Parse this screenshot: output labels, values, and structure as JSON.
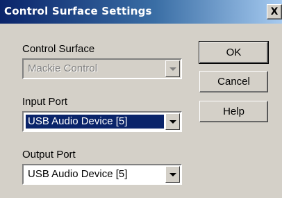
{
  "window": {
    "title": "Control Surface Settings",
    "close_glyph": "X"
  },
  "form": {
    "control_surface": {
      "label": "Control Surface",
      "value": "Mackie Control",
      "enabled": false
    },
    "input_port": {
      "label": "Input Port",
      "value": "USB Audio Device [5]",
      "focused": true
    },
    "output_port": {
      "label": "Output Port",
      "value": "USB Audio Device [5]"
    }
  },
  "buttons": {
    "ok": "OK",
    "cancel": "Cancel",
    "help": "Help"
  }
}
